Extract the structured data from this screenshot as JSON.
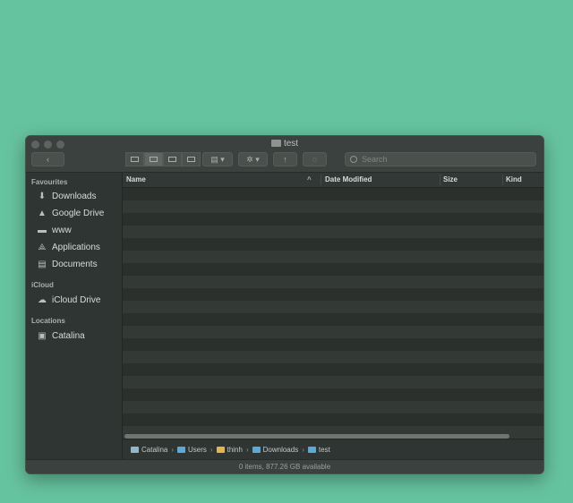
{
  "window": {
    "title": "test"
  },
  "toolbar": {
    "back_label": "‹",
    "arrange_label": "▤ ▾",
    "action_label": "✲ ▾",
    "share_label": "↑",
    "tag_label": "◌",
    "search_placeholder": "Search"
  },
  "sidebar": {
    "sections": [
      {
        "heading": "Favourites",
        "items": [
          {
            "label": "Downloads",
            "icon": "download-icon"
          },
          {
            "label": "Google Drive",
            "icon": "google-drive-icon"
          },
          {
            "label": "www",
            "icon": "folder-icon"
          },
          {
            "label": "Applications",
            "icon": "applications-icon"
          },
          {
            "label": "Documents",
            "icon": "document-icon"
          }
        ]
      },
      {
        "heading": "iCloud",
        "items": [
          {
            "label": "iCloud Drive",
            "icon": "cloud-icon"
          }
        ]
      },
      {
        "heading": "Locations",
        "items": [
          {
            "label": "Catalina",
            "icon": "disk-icon"
          }
        ]
      }
    ]
  },
  "columns": {
    "name": "Name",
    "date_modified": "Date Modified",
    "size": "Size",
    "kind": "Kind"
  },
  "path": [
    {
      "label": "Catalina",
      "icon": "disk-icon",
      "color": "#8fb8c9"
    },
    {
      "label": "Users",
      "icon": "folder-icon",
      "color": "#5aa9d6"
    },
    {
      "label": "thinh",
      "icon": "home-icon",
      "color": "#e3b54f"
    },
    {
      "label": "Downloads",
      "icon": "folder-icon",
      "color": "#5aa9d6"
    },
    {
      "label": "test",
      "icon": "folder-icon",
      "color": "#5aa9d6"
    }
  ],
  "status": {
    "text": "0 items, 877.26 GB available"
  },
  "colors": {
    "background": "#66c3a0",
    "window": "#2f3532"
  }
}
